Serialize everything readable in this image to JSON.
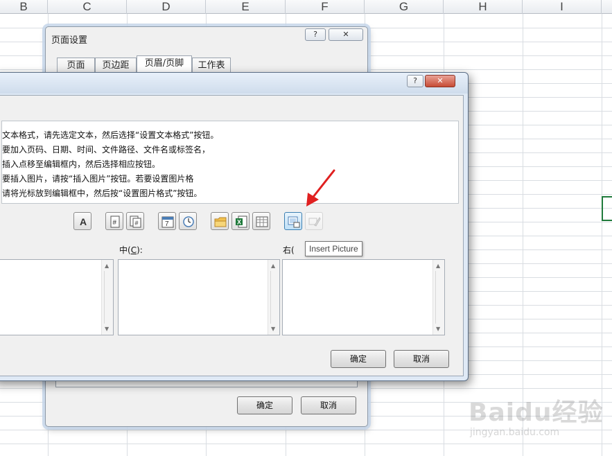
{
  "sheet": {
    "columns": [
      "B",
      "C",
      "D",
      "E",
      "F",
      "G",
      "H",
      "I"
    ]
  },
  "page_setup": {
    "title": "页面设置",
    "help": "?",
    "close": "✕",
    "tabs": [
      {
        "label": "页面"
      },
      {
        "label": "页边距"
      },
      {
        "label": "页眉/页脚"
      },
      {
        "label": "工作表"
      }
    ],
    "ok": "确定",
    "cancel": "取消"
  },
  "header_dialog": {
    "help": "?",
    "close": "✕",
    "instructions": [
      "文本格式，请先选定文本，然后选择“设置文本格式”按钮。",
      "要加入页码、日期、时间、文件路径、文件名或标签名，",
      "插入点移至编辑框内，然后选择相应按钮。",
      "要插入图片，请按“插入图片”按钮。若要设置图片格",
      "请将光标放到编辑框中，然后按“设置图片格式”按钮。"
    ],
    "toolbar": [
      {
        "name": "format-text-icon",
        "glyph": "A"
      },
      {
        "name": "page-number-icon",
        "glyph": "#"
      },
      {
        "name": "page-count-icon",
        "glyph": "#"
      },
      {
        "name": "date-icon",
        "glyph": "7"
      },
      {
        "name": "time-icon",
        "glyph": "◷"
      },
      {
        "name": "file-path-icon",
        "glyph": ""
      },
      {
        "name": "file-name-icon",
        "glyph": "X"
      },
      {
        "name": "sheet-name-icon",
        "glyph": ""
      },
      {
        "name": "insert-picture-icon",
        "glyph": ""
      },
      {
        "name": "format-picture-icon",
        "glyph": ""
      }
    ],
    "center_label_prefix": "中(",
    "center_label_key": "C",
    "center_label_suffix": "):",
    "right_label": "右(",
    "tooltip": "Insert Picture",
    "ok": "确定",
    "cancel": "取消"
  },
  "watermark": {
    "logo": "Baidu经验",
    "url": "jingyan.baidu.com"
  },
  "colors": {
    "arrow": "#e02020",
    "selected_cell": "#1f7a3b"
  }
}
